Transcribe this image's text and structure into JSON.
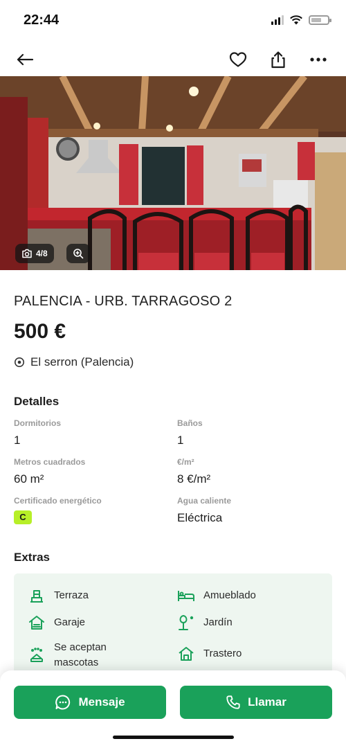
{
  "status_bar": {
    "time": "22:44",
    "icons": [
      "cellular-signal-icon",
      "wifi-icon",
      "battery-icon"
    ]
  },
  "nav": {
    "icons": [
      "back-arrow-icon",
      "heart-icon",
      "share-icon",
      "more-icon"
    ]
  },
  "gallery": {
    "counter": "4/8",
    "icons": [
      "camera-icon",
      "zoom-icon"
    ]
  },
  "listing": {
    "title": "PALENCIA - URB. TARRAGOSO 2",
    "price": "500 €",
    "location": "El serron (Palencia)"
  },
  "details": {
    "heading": "Detalles",
    "items": [
      {
        "label": "Dormitorios",
        "value": "1"
      },
      {
        "label": "Baños",
        "value": "1"
      },
      {
        "label": "Metros cuadrados",
        "value": "60 m²"
      },
      {
        "label": "€/m²",
        "value": "8 €/m²"
      },
      {
        "label": "Certificado energético",
        "value": "C"
      },
      {
        "label": "Agua caliente",
        "value": "Eléctrica"
      }
    ]
  },
  "extras": {
    "heading": "Extras",
    "items": [
      {
        "label": "Terraza",
        "icon": "terrace-icon"
      },
      {
        "label": "Amueblado",
        "icon": "furnished-icon"
      },
      {
        "label": "Garaje",
        "icon": "garage-icon"
      },
      {
        "label": "Jardín",
        "icon": "garden-icon"
      },
      {
        "label": "Se aceptan mascotas",
        "icon": "pets-icon"
      },
      {
        "label": "Trastero",
        "icon": "storage-room-icon"
      }
    ]
  },
  "actions": {
    "message_label": "Mensaje",
    "call_label": "Llamar"
  },
  "colors": {
    "accent_green": "#1aa15a",
    "energy_badge": "#b7ef28",
    "extras_background": "#eef6f0"
  }
}
